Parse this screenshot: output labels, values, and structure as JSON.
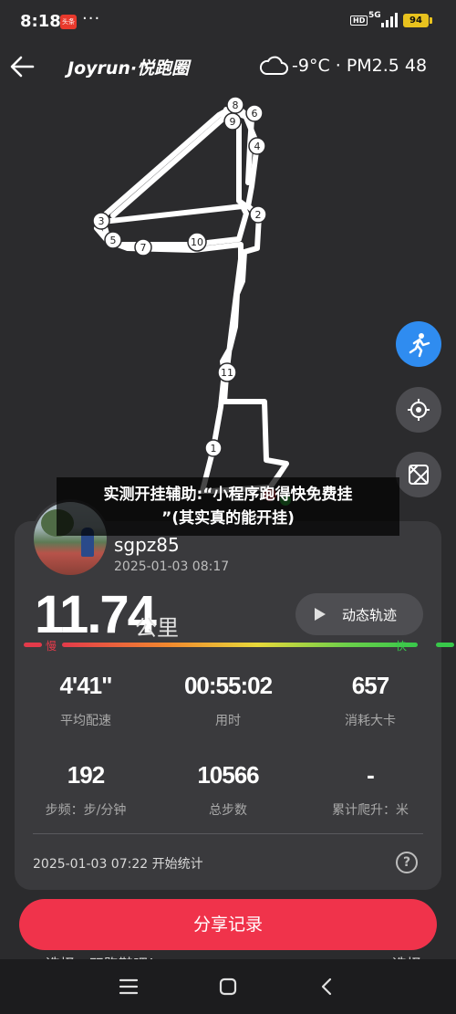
{
  "status_bar": {
    "time": "8:18",
    "app_badge": "头条",
    "dots": "···",
    "hd": "HD",
    "network": "5G",
    "battery": "94"
  },
  "header": {
    "brand": "Joyrun·悦跑圈",
    "weather": "-9°C · PM2.5 48"
  },
  "map": {
    "markers": [
      "1",
      "2",
      "3",
      "4",
      "5",
      "6",
      "7",
      "8",
      "9",
      "10",
      "11"
    ]
  },
  "banner": {
    "line1": "实测开挂辅助:“小程序跑得快免费挂",
    "line2": "”(其实真的能开挂)"
  },
  "profile": {
    "username": "sgpz85",
    "date": "2025-01-03 08:17"
  },
  "run": {
    "distance": "11.74",
    "distance_unit": "公里",
    "track_label": "动态轨迹",
    "pace_slow": "慢",
    "pace_fast": "快"
  },
  "stats": [
    {
      "value": "4'41\"",
      "label": "平均配速"
    },
    {
      "value": "00:55:02",
      "label": "用时"
    },
    {
      "value": "657",
      "label": "消耗大卡"
    },
    {
      "value": "192",
      "label": "步频：步/分钟"
    },
    {
      "value": "10566",
      "label": "总步数"
    },
    {
      "value": "-",
      "label": "累计爬升：米"
    }
  ],
  "footer": {
    "start_info": "2025-01-03 07:22  开始统计",
    "help": "?",
    "share_label": "分享记录",
    "partial_left": "选择一双跑鞋吧！",
    "partial_right": "选择"
  },
  "colors": {
    "accent": "#f0334b",
    "blue": "#2f8cf0",
    "background": "#2b2b2d",
    "card": "#3a3a3d"
  }
}
